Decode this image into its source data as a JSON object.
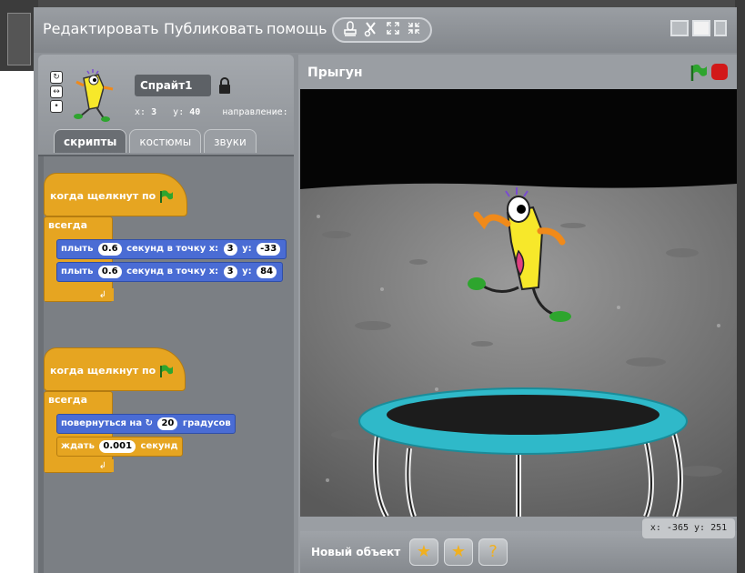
{
  "menu": {
    "edit": "Редактировать",
    "publish": "Публиковать",
    "help": "помощь"
  },
  "toolbar": {
    "tools": [
      "stamp-icon",
      "scissors-icon",
      "grow-icon",
      "shrink-icon"
    ]
  },
  "sprite": {
    "name": "Спрайт1",
    "x_label": "x:",
    "x_value": "3",
    "y_label": "y:",
    "y_value": "40",
    "direction_label": "направление:"
  },
  "tabs": [
    "скрипты",
    "костюмы",
    "звуки"
  ],
  "scripts": {
    "script1": {
      "hat": "когда щелкнут по",
      "forever": "всегда",
      "glide1": {
        "a": "плыть",
        "secs": "0.6",
        "b": "секунд в точку x:",
        "x": "3",
        "c": "y:",
        "y": "-33"
      },
      "glide2": {
        "a": "плыть",
        "secs": "0.6",
        "b": "секунд в точку x:",
        "x": "3",
        "c": "y:",
        "y": "84"
      }
    },
    "script2": {
      "hat": "когда щелкнут по",
      "forever": "всегда",
      "turn": {
        "a": "повернуться на",
        "deg": "20",
        "b": "градусов"
      },
      "wait": {
        "a": "ждать",
        "secs": "0.001",
        "b": "секунд"
      }
    }
  },
  "stage": {
    "title": "Прыгун",
    "coords": "x: -365   y: 251"
  },
  "new_sprite": {
    "label": "Новый объект"
  },
  "colors": {
    "control_block": "#e6a521",
    "motion_block": "#4a6cd4",
    "trampoline": "#2fb9c9",
    "stop": "#d21919",
    "flag": "#2ea52e"
  }
}
